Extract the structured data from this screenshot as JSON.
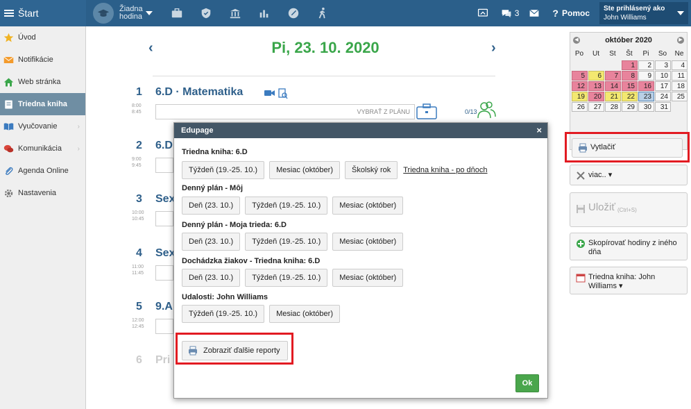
{
  "topbar": {
    "brand": "Štart",
    "hour_label_1": "Žiadna",
    "hour_label_2": "hodina",
    "nav_icons": [
      "briefcase-icon",
      "shield-icon",
      "bank-icon",
      "bar-chart-icon",
      "clock-icon",
      "walking-icon"
    ],
    "messages_count": "3",
    "help_label": "Pomoc",
    "user_line1": "Ste prihlásený ako",
    "user_line2": "John Williams"
  },
  "sidebar": {
    "items": [
      {
        "label": "Úvod",
        "icon": "star-icon"
      },
      {
        "label": "Notifikácie",
        "icon": "envelope-icon"
      },
      {
        "label": "Web stránka",
        "icon": "house-icon"
      },
      {
        "label": "Triedna kniha",
        "icon": "book-icon"
      },
      {
        "label": "Vyučovanie",
        "icon": "open-book-icon"
      },
      {
        "label": "Komunikácia",
        "icon": "chat-icon"
      },
      {
        "label": "Agenda Online",
        "icon": "paperclip-icon"
      },
      {
        "label": "Nastavenia",
        "icon": "gear-icon"
      }
    ],
    "active_index": 3
  },
  "main": {
    "date_title": "Pi, 23. 10. 2020",
    "lessons": [
      {
        "num": "1",
        "time1": "8:00",
        "time2": "8:45",
        "title": "6.D · Matematika",
        "field": "VYBRAŤ Z PLÁNU",
        "count": "0/13"
      },
      {
        "num": "2",
        "time1": "9:00",
        "time2": "9:45",
        "title": "6.D"
      },
      {
        "num": "3",
        "time1": "10:00",
        "time2": "10:45",
        "title": "Sex"
      },
      {
        "num": "4",
        "time1": "11:00",
        "time2": "11:45",
        "title": "Sex"
      },
      {
        "num": "5",
        "time1": "12:00",
        "time2": "12:45",
        "title": "9.A"
      },
      {
        "num": "6",
        "title": "Pri"
      }
    ]
  },
  "calendar": {
    "month": "október 2020",
    "day_names": [
      "Po",
      "Ut",
      "St",
      "Št",
      "Pi",
      "So",
      "Ne"
    ],
    "cells": [
      {
        "d": "",
        "c": "empty"
      },
      {
        "d": "",
        "c": "empty"
      },
      {
        "d": "",
        "c": "empty"
      },
      {
        "d": "1",
        "c": "pink"
      },
      {
        "d": "2",
        "c": ""
      },
      {
        "d": "3",
        "c": ""
      },
      {
        "d": "4",
        "c": ""
      },
      {
        "d": "5",
        "c": "pink"
      },
      {
        "d": "6",
        "c": "yellow"
      },
      {
        "d": "7",
        "c": "pink"
      },
      {
        "d": "8",
        "c": "pink"
      },
      {
        "d": "9",
        "c": ""
      },
      {
        "d": "10",
        "c": ""
      },
      {
        "d": "11",
        "c": ""
      },
      {
        "d": "12",
        "c": "pink"
      },
      {
        "d": "13",
        "c": "pink"
      },
      {
        "d": "14",
        "c": "pink"
      },
      {
        "d": "15",
        "c": "pink"
      },
      {
        "d": "16",
        "c": "pink"
      },
      {
        "d": "17",
        "c": ""
      },
      {
        "d": "18",
        "c": ""
      },
      {
        "d": "19",
        "c": "yellow"
      },
      {
        "d": "20",
        "c": "pink"
      },
      {
        "d": "21",
        "c": "yellow"
      },
      {
        "d": "22",
        "c": "yellow"
      },
      {
        "d": "23",
        "c": "today"
      },
      {
        "d": "24",
        "c": ""
      },
      {
        "d": "25",
        "c": ""
      },
      {
        "d": "26",
        "c": ""
      },
      {
        "d": "27",
        "c": ""
      },
      {
        "d": "28",
        "c": ""
      },
      {
        "d": "29",
        "c": ""
      },
      {
        "d": "30",
        "c": ""
      },
      {
        "d": "31",
        "c": ""
      },
      {
        "d": "",
        "c": "empty"
      }
    ]
  },
  "right": {
    "print_label": "Vytlačiť",
    "more_label": "viac.. ▾",
    "save_label": "Uložiť",
    "save_shortcut": "(Ctrl+S)",
    "copy_label": "Skopírovať hodiny z iného dňa",
    "classbook_label": "Triedna kniha: John Williams ▾"
  },
  "modal": {
    "title": "Edupage",
    "close": "×",
    "sections": [
      {
        "heading": "Triedna kniha: 6.D",
        "buttons": [
          "Týždeň (19.-25. 10.)",
          "Mesiac (október)",
          "Školský rok"
        ],
        "link": "Triedna kniha - po dňoch"
      },
      {
        "heading": "Denný plán - Môj",
        "buttons": [
          "Deň (23. 10.)",
          "Týždeň (19.-25. 10.)",
          "Mesiac (október)"
        ]
      },
      {
        "heading": "Denný plán - Moja trieda: 6.D",
        "buttons": [
          "Deň (23. 10.)",
          "Týždeň (19.-25. 10.)",
          "Mesiac (október)"
        ]
      },
      {
        "heading": "Dochádzka žiakov - Triedna kniha: 6.D",
        "buttons": [
          "Deň (23. 10.)",
          "Týždeň (19.-25. 10.)",
          "Mesiac (október)"
        ]
      },
      {
        "heading": "Udalosti: John Williams",
        "buttons": [
          "Týždeň (19.-25. 10.)",
          "Mesiac (október)"
        ]
      }
    ],
    "more_reports": "Zobraziť ďalšie reporty",
    "ok": "Ok"
  },
  "colors": {
    "topbar": "#2b5f8a",
    "accent_green": "#3aa64a",
    "highlight_red": "#e21b22",
    "modal_header": "#435666"
  }
}
